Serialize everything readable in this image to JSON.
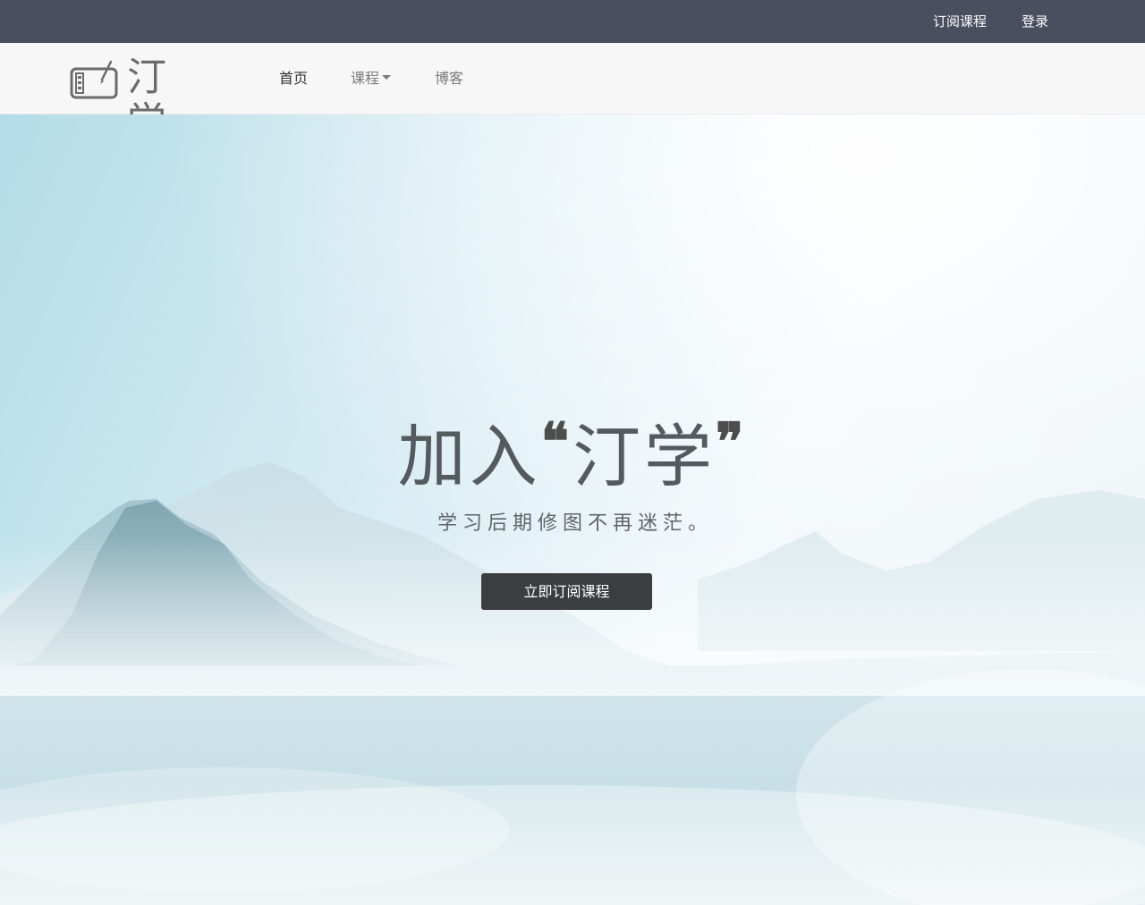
{
  "topbar": {
    "subscribe_label": "订阅课程",
    "login_label": "登录",
    "bg_color": "#4a4f60"
  },
  "navbar": {
    "brand_text": "汀学",
    "brand_icon": "drawing-tablet-icon",
    "items": [
      {
        "label": "首页",
        "active": true
      },
      {
        "label": "课程",
        "has_dropdown": true
      },
      {
        "label": "博客"
      }
    ]
  },
  "hero": {
    "title_prefix": "加入",
    "open_quote": "❝",
    "title_brand": "汀学",
    "close_quote": "❞",
    "subtitle": "学习后期修图不再迷茫。",
    "cta_label": "立即订阅课程",
    "cta_color": "#3b3d3f"
  }
}
